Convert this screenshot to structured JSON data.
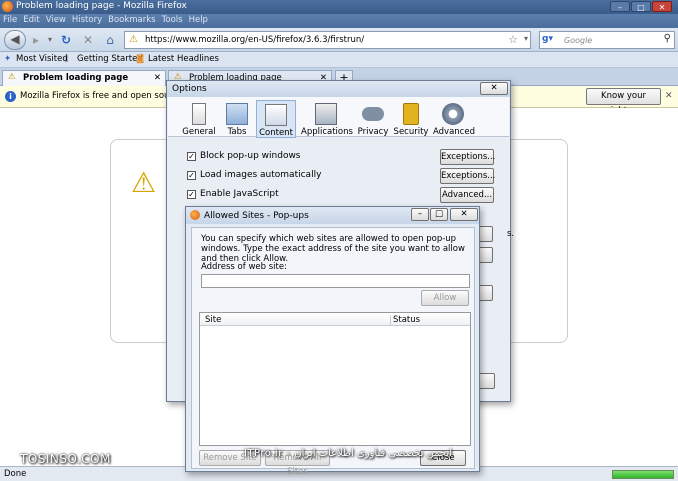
{
  "window": {
    "title": "Problem loading page - Mozilla Firefox",
    "controls": [
      "–",
      "□",
      "✕"
    ]
  },
  "menu": [
    "File",
    "Edit",
    "View",
    "History",
    "Bookmarks",
    "Tools",
    "Help"
  ],
  "nav": {
    "url": "https://www.mozilla.org/en-US/firefox/3.6.3/firstrun/",
    "search_placeholder": "Google",
    "search_engine_icon": "google-icon"
  },
  "bookmarks": [
    "Most Visited",
    "Getting Started",
    "Latest Headlines"
  ],
  "tabs": [
    {
      "label": "Problem loading page",
      "close": "✕"
    },
    {
      "label": "Problem loading page",
      "close": "✕"
    }
  ],
  "new_tab": "+",
  "infobar": {
    "message": "Mozilla Firefox is free and open source sof",
    "button": "Know your rights..."
  },
  "status": "Done",
  "options": {
    "title": "Options",
    "close": "✕",
    "categories": [
      "General",
      "Tabs",
      "Content",
      "Applications",
      "Privacy",
      "Security",
      "Advanced"
    ],
    "selected": "Content",
    "rows": [
      {
        "label": "Block pop-up windows",
        "checked": "✓",
        "button": "Exceptions..."
      },
      {
        "label": "Load images automatically",
        "checked": "✓",
        "button": "Exceptions..."
      },
      {
        "label": "Enable JavaScript",
        "checked": "✓",
        "button": "Advanced..."
      }
    ],
    "truncated_text": "s."
  },
  "allowed": {
    "title": "Allowed Sites - Pop-ups",
    "description": "You can specify which web sites are allowed to open pop-up windows. Type the exact address of the site you want to allow and then click Allow.",
    "address_label": "Address of web site:",
    "address_value": "",
    "allow_button": "Allow",
    "columns": [
      "Site",
      "Status"
    ],
    "remove_site": "Remove Site",
    "remove_all": "Remove All Sites",
    "close_button": "Close",
    "controls": [
      "–",
      "□",
      "✕"
    ]
  },
  "watermarks": {
    "left": "TOSINSO.COM",
    "right": "ITPro.ir - انجمن تخصصی فناوری اطلاعات ایران"
  }
}
